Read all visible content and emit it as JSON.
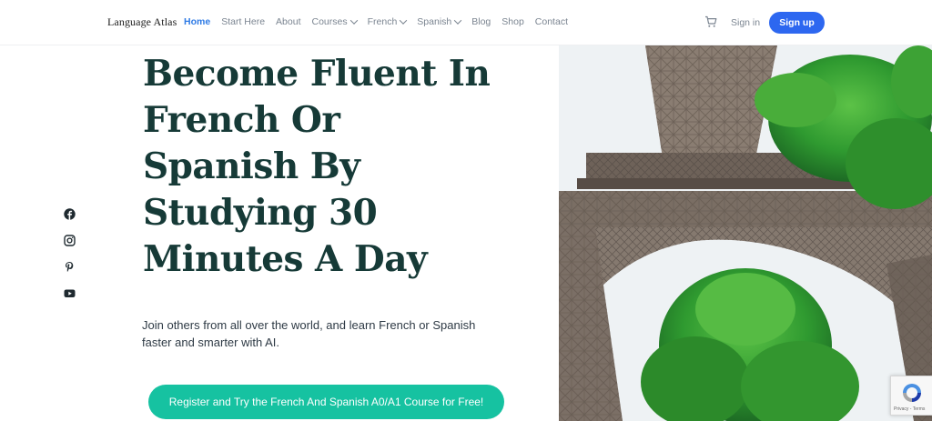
{
  "header": {
    "brand": "Language Atlas",
    "nav": [
      {
        "label": "Home",
        "active": true,
        "dropdown": false
      },
      {
        "label": "Start Here",
        "active": false,
        "dropdown": false
      },
      {
        "label": "About",
        "active": false,
        "dropdown": false
      },
      {
        "label": "Courses",
        "active": false,
        "dropdown": true
      },
      {
        "label": "French",
        "active": false,
        "dropdown": true
      },
      {
        "label": "Spanish",
        "active": false,
        "dropdown": true
      },
      {
        "label": "Blog",
        "active": false,
        "dropdown": false
      },
      {
        "label": "Shop",
        "active": false,
        "dropdown": false
      },
      {
        "label": "Contact",
        "active": false,
        "dropdown": false
      }
    ],
    "cart_icon": "cart-icon",
    "signin": "Sign in",
    "signup": "Sign up"
  },
  "hero": {
    "title_lines": [
      "Become Fluent In",
      "French Or",
      "Spanish By",
      "Studying 30",
      "Minutes A Day"
    ],
    "subtitle_line1": "Join others from all over the world, and learn French or Spanish",
    "subtitle_line2": "faster and smarter with AI.",
    "cta": "Register and Try the French And Spanish A0/A1 Course for Free!"
  },
  "social": [
    "facebook-icon",
    "instagram-icon",
    "pinterest-icon",
    "youtube-icon"
  ],
  "recaptcha": {
    "text": "Privacy - Terms"
  },
  "colors": {
    "accent": "#2f7be5",
    "signup_bg": "#2d67f0",
    "title": "#163a37",
    "cta_bg": "#16c2a1"
  }
}
